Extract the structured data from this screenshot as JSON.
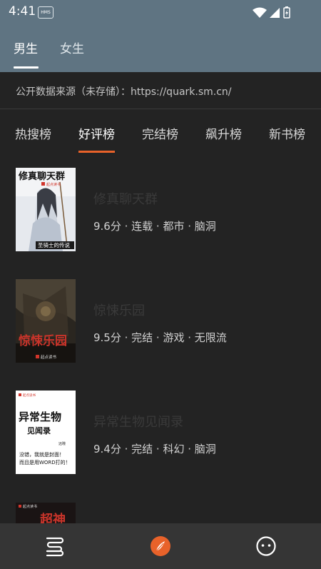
{
  "status_bar": {
    "time": "4:41",
    "hms_badge": "HMS"
  },
  "gender_tabs": [
    {
      "label": "男生",
      "active": true
    },
    {
      "label": "女生",
      "active": false
    }
  ],
  "source_text": "公开数据来源（未存储）：https://quark.sm.cn/",
  "ranking_tabs": [
    {
      "label": "热搜榜",
      "active": false
    },
    {
      "label": "好评榜",
      "active": true
    },
    {
      "label": "完结榜",
      "active": false
    },
    {
      "label": "飙升榜",
      "active": false
    },
    {
      "label": "新书榜",
      "active": false
    }
  ],
  "books": [
    {
      "title": "修真聊天群",
      "meta": "9.6分 · 连载 · 都市 · 脑洞",
      "cover_title": "修真聊天群",
      "cover_author": "圣骑士的传说",
      "cover_publisher": "起点读书"
    },
    {
      "title": "惊悚乐园",
      "meta": "9.5分 · 完结 · 游戏 · 无限流",
      "cover_title": "惊悚乐园",
      "cover_publisher": "起点读书"
    },
    {
      "title": "异常生物见闻录",
      "meta": "9.4分 · 完结 · 科幻 · 脑洞",
      "cover_title_line1": "异常生物",
      "cover_title_line2": "见闻录",
      "cover_blurb1": "没错，我就是封面！",
      "cover_blurb2": "而且是用WORD打的！",
      "cover_author": "远瞳",
      "cover_publisher": "起点读书"
    },
    {
      "cover_title": "超神",
      "cover_publisher": "起点读书"
    }
  ],
  "colors": {
    "accent": "#e8622a",
    "header": "#5f7482",
    "background": "#232323",
    "nav": "#353535"
  },
  "bottom_nav": [
    {
      "icon": "bookshelf-icon"
    },
    {
      "icon": "discover-compass-icon",
      "active": true
    },
    {
      "icon": "profile-face-icon"
    }
  ]
}
